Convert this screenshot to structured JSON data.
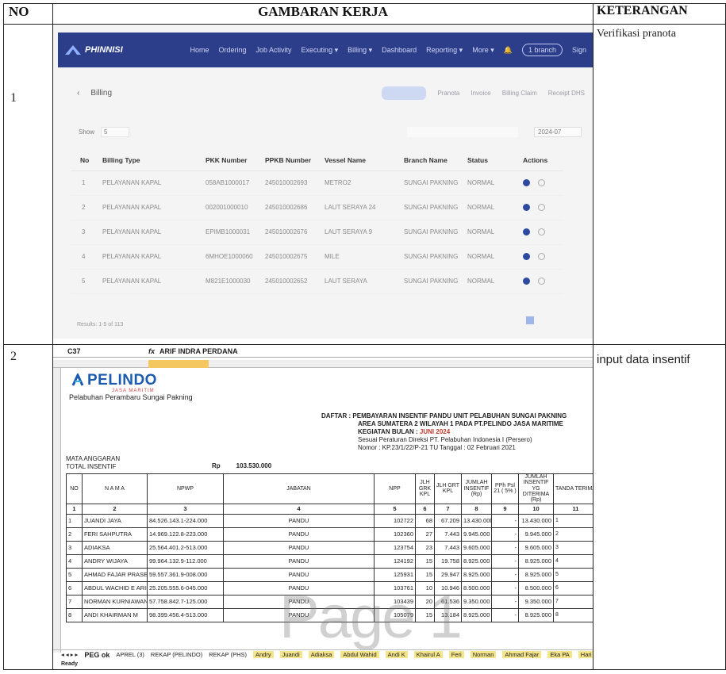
{
  "header": {
    "no": "NO",
    "gambaran": "GAMBARAN KERJA",
    "keterangan": "KETERANGAN"
  },
  "rows": [
    {
      "no": "1",
      "keterangan": "Verifikasi pranota"
    },
    {
      "no": "2",
      "keterangan": "input data insentif"
    }
  ],
  "app": {
    "brand": "PHINNISI",
    "nav": [
      "Home",
      "Ordering",
      "Job Activity",
      "Executing ▾",
      "Billing ▾",
      "Dashboard",
      "Reporting ▾",
      "More ▾"
    ],
    "branch_button": "1 branch",
    "user": "Sign",
    "page_title": "Billing",
    "tabs": [
      "Pranota",
      "Invoice",
      "Billing Claim",
      "Receipt DHS"
    ],
    "show_label": "Show",
    "show_value": "5",
    "date_value": "2024-07",
    "columns": [
      "No",
      "Billing Type",
      "PKK Number",
      "PPKB Number",
      "Vessel Name",
      "Branch Name",
      "Status",
      "Actions"
    ],
    "bills": [
      {
        "no": "1",
        "type": "PELAYANAN KAPAL",
        "pkk": "058AB1000017",
        "ppkb": "245010002693",
        "vessel": "METRO2",
        "branch": "SUNGAI PAKNING",
        "status": "NORMAL"
      },
      {
        "no": "2",
        "type": "PELAYANAN KAPAL",
        "pkk": "002001000010",
        "ppkb": "245010002686",
        "vessel": "LAUT SERAYA 24",
        "branch": "SUNGAI PAKNING",
        "status": "NORMAL"
      },
      {
        "no": "3",
        "type": "PELAYANAN KAPAL",
        "pkk": "EPIMB1000031",
        "ppkb": "245010002676",
        "vessel": "LAUT SERAYA 9",
        "branch": "SUNGAI PAKNING",
        "status": "NORMAL"
      },
      {
        "no": "4",
        "type": "PELAYANAN KAPAL",
        "pkk": "6MHOE1000060",
        "ppkb": "245010002675",
        "vessel": "MILE",
        "branch": "SUNGAI PAKNING",
        "status": "NORMAL"
      },
      {
        "no": "5",
        "type": "PELAYANAN KAPAL",
        "pkk": "M821E1000030",
        "ppkb": "245010002652",
        "vessel": "LAUT SERAYA",
        "branch": "SUNGAI PAKNING",
        "status": "NORMAL"
      }
    ],
    "results": "Results: 1-5 of 113"
  },
  "excel": {
    "cell_ref": "C37",
    "fx": "fx",
    "formula_value": "ARIF INDRA PERDANA",
    "logo_word": "PELINDO",
    "logo_sub": "JASA MARITIM",
    "branch_name": "Pelabuhan Perambaru Sungai Pakning",
    "daftar_line1": "DAFTAR : PEMBAYARAN INSENTIF  PANDU UNIT PELABUHAN SUNGAI PAKNING",
    "daftar_line2": "AREA SUMATERA 2  WILAYAH 1 PADA PT.PELINDO JASA MARITIME",
    "kegiatan_label": "KEGIATAN BULAN : ",
    "kegiatan_value": "JUNI 2024",
    "sesuai1": "Sesuai Peraturan Direksi PT. Pelabuhan Indonesia I (Persero)",
    "sesuai2": "Nomor : KP.23/1/22/P-21 TU  Tanggal : 02 Februari 2021",
    "mata_anggaran": "MATA ANGGARAN",
    "total_insentif": "TOTAL INSENTIF",
    "rp": "Rp",
    "total_value": "103.530.000",
    "columns": [
      "NO",
      "N A M A",
      "NPWP",
      "JABATAN",
      "NPP",
      "JLH GRK KPL",
      "JLH GRT KPL",
      "JUMLAH INSENTIF (Rp)",
      "PPh Psl 21 ( 5% )",
      "JUMLAH INSENTIF YG DITERIMA (Rp)",
      "TANDA TERIMA"
    ],
    "col_index": [
      "1",
      "2",
      "3",
      "4",
      "5",
      "6",
      "7",
      "8",
      "9",
      "10",
      "11"
    ],
    "people": [
      {
        "no": "1",
        "nama": "JUANDI JAYA",
        "npwp": "84.526.143.1-224.000",
        "jabatan": "PANDU",
        "npp": "102722",
        "grk": "68",
        "grt": "67.209",
        "jumlah": "13.430.000",
        "pph": "-",
        "diterima": "13.430.000",
        "tt": "1"
      },
      {
        "no": "2",
        "nama": "FERI SAHPUTRA",
        "npwp": "14.969.122.8-223.000",
        "jabatan": "PANDU",
        "npp": "102360",
        "grk": "27",
        "grt": "7.443",
        "jumlah": "9.945.000",
        "pph": "-",
        "diterima": "9.945.000",
        "tt": "2"
      },
      {
        "no": "3",
        "nama": "ADIAKSA",
        "npwp": "25.564.401.2-513.000",
        "jabatan": "PANDU",
        "npp": "123754",
        "grk": "23",
        "grt": "7.443",
        "jumlah": "9.605.000",
        "pph": "-",
        "diterima": "9.605.000",
        "tt": "3"
      },
      {
        "no": "4",
        "nama": "ANDRY WIJAYA",
        "npwp": "99.964.132.9-112.000",
        "jabatan": "PANDU",
        "npp": "124192",
        "grk": "15",
        "grt": "19.758",
        "jumlah": "8.925.000",
        "pph": "-",
        "diterima": "8.925.000",
        "tt": "4"
      },
      {
        "no": "5",
        "nama": "AHMAD FAJAR PRASETYO",
        "npwp": "59.557.361.9-008.000",
        "jabatan": "PANDU",
        "npp": "125931",
        "grk": "15",
        "grt": "29.947",
        "jumlah": "8.925.000",
        "pph": "-",
        "diterima": "8.925.000",
        "tt": "5"
      },
      {
        "no": "6",
        "nama": "ABDUL WACHID E ARIF",
        "npwp": "25.205.555.6-045.000",
        "jabatan": "PANDU",
        "npp": "103761",
        "grk": "10",
        "grt": "10.946",
        "jumlah": "8.500.000",
        "pph": "-",
        "diterima": "8.500.000",
        "tt": "6"
      },
      {
        "no": "7",
        "nama": "NORMAN KURNIAWAN",
        "npwp": "57.758.842.7-125.000",
        "jabatan": "PANDU",
        "npp": "103439",
        "grk": "20",
        "grt": "61.536",
        "jumlah": "9.350.000",
        "pph": "-",
        "diterima": "9.350.000",
        "tt": "7"
      },
      {
        "no": "8",
        "nama": "ANDI KHAIRMAN M",
        "npwp": "98.399.456.4-513.000",
        "jabatan": "PANDU",
        "npp": "105079",
        "grk": "15",
        "grt": "13.184",
        "jumlah": "8.925.000",
        "pph": "-",
        "diterima": "8.925.000",
        "tt": "8"
      }
    ],
    "watermark": "Page 1",
    "sheet_nav": "◂ ◂ ▸ ▸",
    "sheets": [
      "PEG ok",
      "APREL (3)",
      "REKAP (PELINDO)",
      "REKAP (PHS)",
      "Andry",
      "Juandi",
      "Adiaksa",
      "Abdul Wahid",
      "Andi K",
      "Khairul A",
      "Feri",
      "Norman",
      "Ahmad Fajar",
      "Eka PA",
      "Hari Saputra"
    ],
    "status_bar": "Ready"
  }
}
